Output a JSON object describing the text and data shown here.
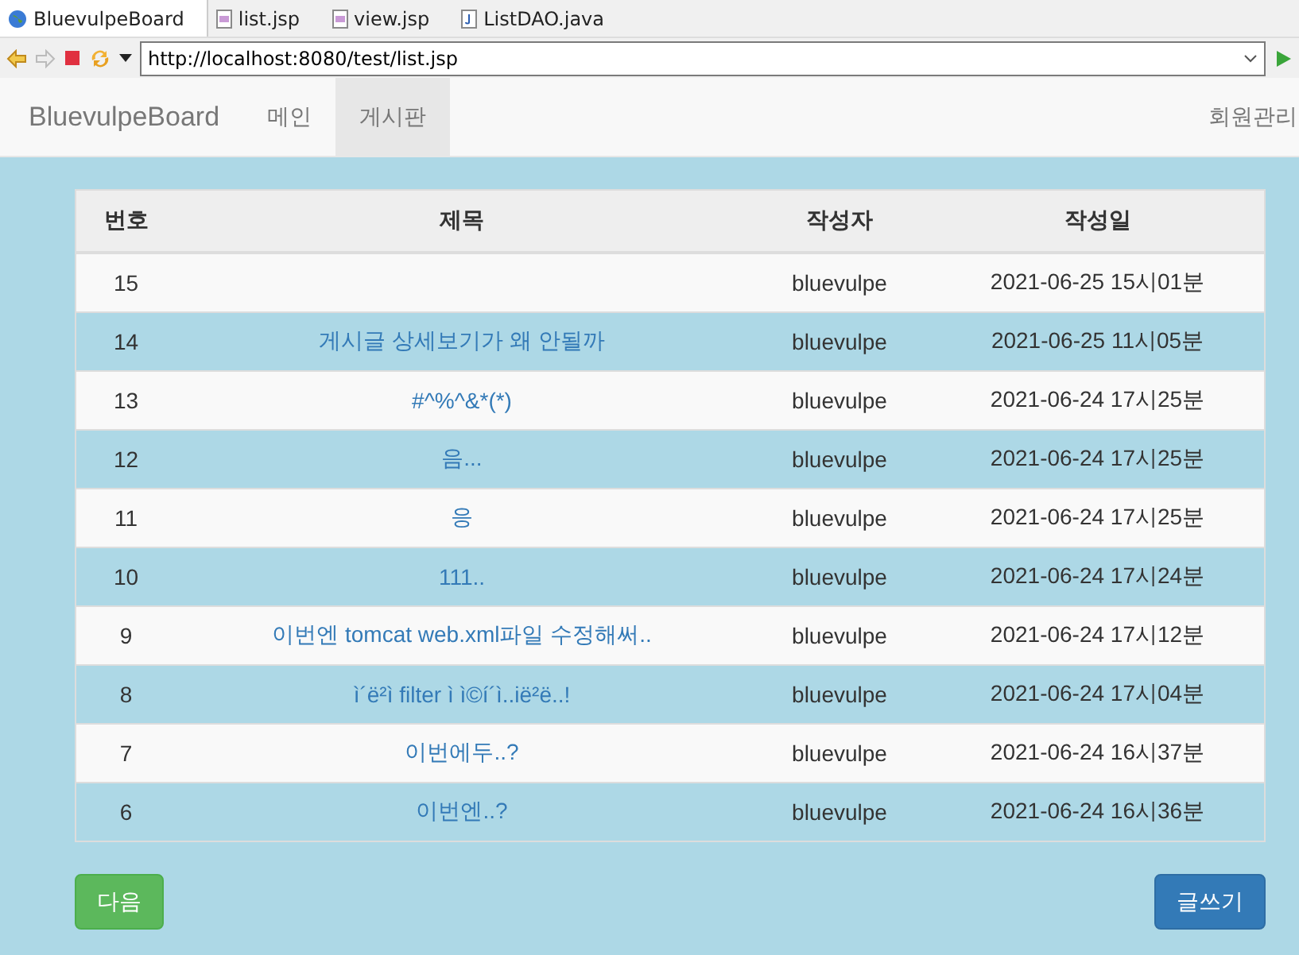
{
  "editor_tabs": [
    {
      "label": "BluevulpeBoard",
      "kind": "web",
      "selected": true
    },
    {
      "label": "list.jsp",
      "kind": "jsp",
      "selected": false
    },
    {
      "label": "view.jsp",
      "kind": "jsp",
      "selected": false
    },
    {
      "label": "ListDAO.java",
      "kind": "java",
      "selected": false
    }
  ],
  "address": {
    "value": "http://localhost:8080/test/list.jsp"
  },
  "navbar": {
    "brand": "BluevulpeBoard",
    "items": [
      {
        "label": "메인",
        "selected": false
      },
      {
        "label": "게시판",
        "selected": true
      }
    ],
    "right": "회원관리"
  },
  "table": {
    "columns": [
      "번호",
      "제목",
      "작성자",
      "작성일"
    ],
    "rows": [
      {
        "number": "15",
        "author": "bluevulpe",
        "date": "2021-06-25 15시01분"
      },
      {
        "number": "14",
        "title": "게시글 상세보기가 왜 안될까",
        "author": "bluevulpe",
        "date": "2021-06-25 11시05분"
      },
      {
        "number": "13",
        "title": "#^%^&*(*)",
        "author": "bluevulpe",
        "date": "2021-06-24 17시25분"
      },
      {
        "number": "12",
        "title": "음...",
        "author": "bluevulpe",
        "date": "2021-06-24 17시25분"
      },
      {
        "number": "11",
        "title": "응",
        "author": "bluevulpe",
        "date": "2021-06-24 17시25분"
      },
      {
        "number": "10",
        "title": "111..",
        "author": "bluevulpe",
        "date": "2021-06-24 17시24분"
      },
      {
        "number": "9",
        "title": "이번엔 tomcat web.xml파일 수정해써..",
        "author": "bluevulpe",
        "date": "2021-06-24 17시12분"
      },
      {
        "number": "8",
        "title": "ì´ë²ì filter ì ì©í´ì..ië²ë..!",
        "author": "bluevulpe",
        "date": "2021-06-24 17시04분"
      },
      {
        "number": "7",
        "title": "이번에두..?",
        "author": "bluevulpe",
        "date": "2021-06-24 16시37분"
      },
      {
        "number": "6",
        "title": "이번엔..?",
        "author": "bluevulpe",
        "date": "2021-06-24 16시36분"
      }
    ]
  },
  "buttons": {
    "next": "다음",
    "write": "글쓰기"
  }
}
